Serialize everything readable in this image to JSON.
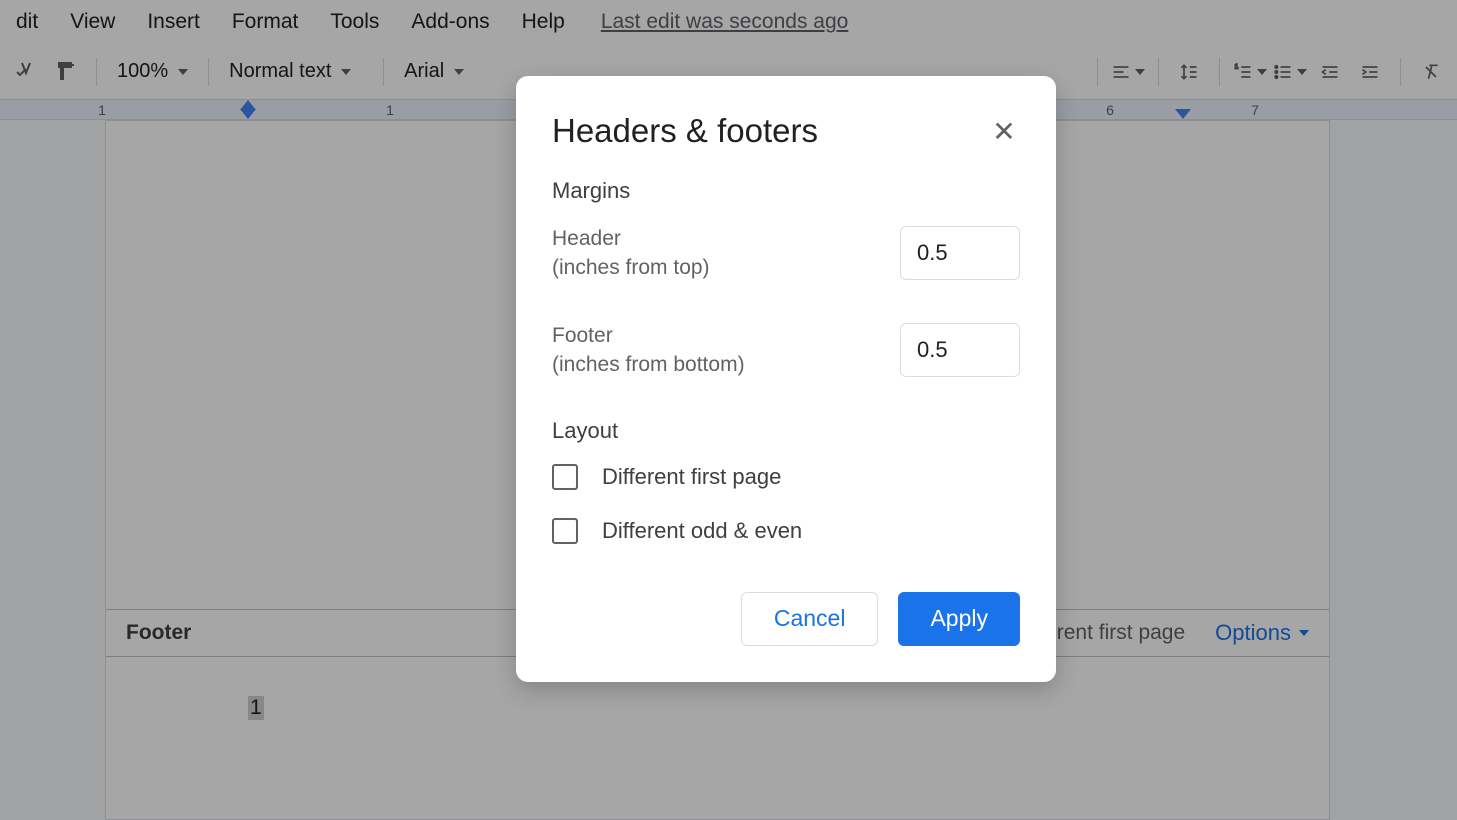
{
  "menu": {
    "items": [
      "dit",
      "View",
      "Insert",
      "Format",
      "Tools",
      "Add-ons",
      "Help"
    ],
    "last_edit": "Last edit was seconds ago"
  },
  "toolbar": {
    "zoom": "100%",
    "style": "Normal text",
    "font": "Arial"
  },
  "ruler": {
    "marks": [
      "1",
      "1",
      "6",
      "7"
    ]
  },
  "footer": {
    "label": "Footer",
    "checkbox_label": "ferent first page",
    "options": "Options",
    "page_number": "1"
  },
  "dialog": {
    "title": "Headers & footers",
    "margins_title": "Margins",
    "header_label_1": "Header",
    "header_label_2": "(inches from top)",
    "header_value": "0.5",
    "footer_label_1": "Footer",
    "footer_label_2": "(inches from bottom)",
    "footer_value": "0.5",
    "layout_title": "Layout",
    "different_first": "Different first page",
    "different_odd_even": "Different odd & even",
    "cancel": "Cancel",
    "apply": "Apply"
  }
}
